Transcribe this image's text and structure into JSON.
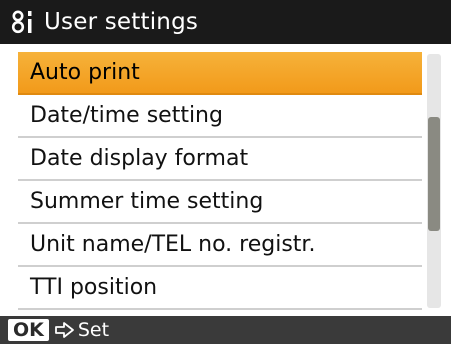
{
  "header": {
    "icon": "settings-icon",
    "title": "User settings"
  },
  "menu": {
    "items": [
      {
        "label": "Auto print",
        "selected": true
      },
      {
        "label": "Date/time setting",
        "selected": false
      },
      {
        "label": "Date display format",
        "selected": false
      },
      {
        "label": "Summer time setting",
        "selected": false
      },
      {
        "label": "Unit name/TEL no. registr.",
        "selected": false
      },
      {
        "label": "TTI position",
        "selected": false
      }
    ],
    "scroll_position": 0.45,
    "scroll_visible_fraction": 0.45
  },
  "footer": {
    "ok_key": "OK",
    "arrow_icon": "arrow-right-icon",
    "hint": "Set"
  },
  "colors": {
    "highlight": "#f4a62a",
    "title_bg": "#1a1a1a",
    "footer_bg": "#3a3a3a"
  }
}
